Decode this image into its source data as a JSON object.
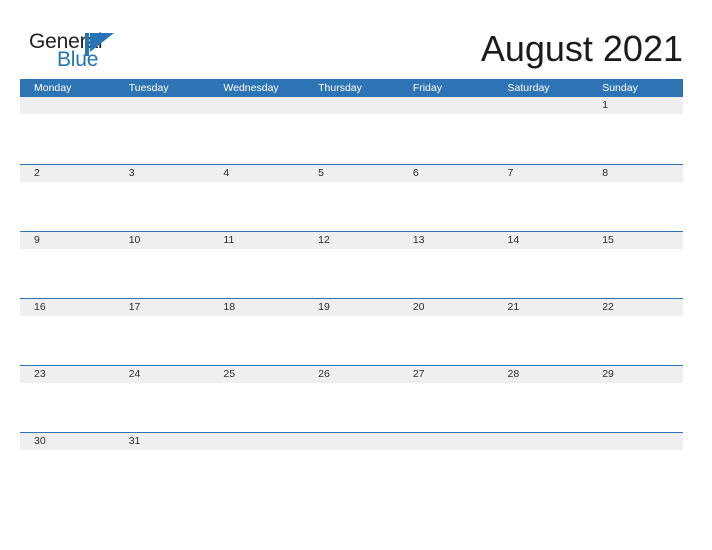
{
  "brand": {
    "name_part1": "General",
    "name_part2": "Blue",
    "flag_icon": "blue-triangle-flag-icon",
    "colors": {
      "dark_text": "#231f20",
      "blue_text": "#2574b7",
      "flag": "#2574b7"
    }
  },
  "header": {
    "title": "August 2021",
    "month": "August",
    "year": "2021"
  },
  "theme": {
    "header_blue": "#2e74b5",
    "row_divider_blue": "#2e74b5",
    "date_band_grey": "#efefef",
    "page_background": "#ffffff",
    "title_color": "#1b1b1b",
    "weekday_text": "#ffffff",
    "date_text": "#2b2b2b"
  },
  "calendar": {
    "week_start": "Monday",
    "weekdays": [
      "Monday",
      "Tuesday",
      "Wednesday",
      "Thursday",
      "Friday",
      "Saturday",
      "Sunday"
    ],
    "weeks": [
      {
        "days": [
          "",
          "",
          "",
          "",
          "",
          "",
          "1"
        ]
      },
      {
        "days": [
          "2",
          "3",
          "4",
          "5",
          "6",
          "7",
          "8"
        ]
      },
      {
        "days": [
          "9",
          "10",
          "11",
          "12",
          "13",
          "14",
          "15"
        ]
      },
      {
        "days": [
          "16",
          "17",
          "18",
          "19",
          "20",
          "21",
          "22"
        ]
      },
      {
        "days": [
          "23",
          "24",
          "25",
          "26",
          "27",
          "28",
          "29"
        ]
      },
      {
        "days": [
          "30",
          "31",
          "",
          "",
          "",
          "",
          ""
        ]
      }
    ]
  }
}
